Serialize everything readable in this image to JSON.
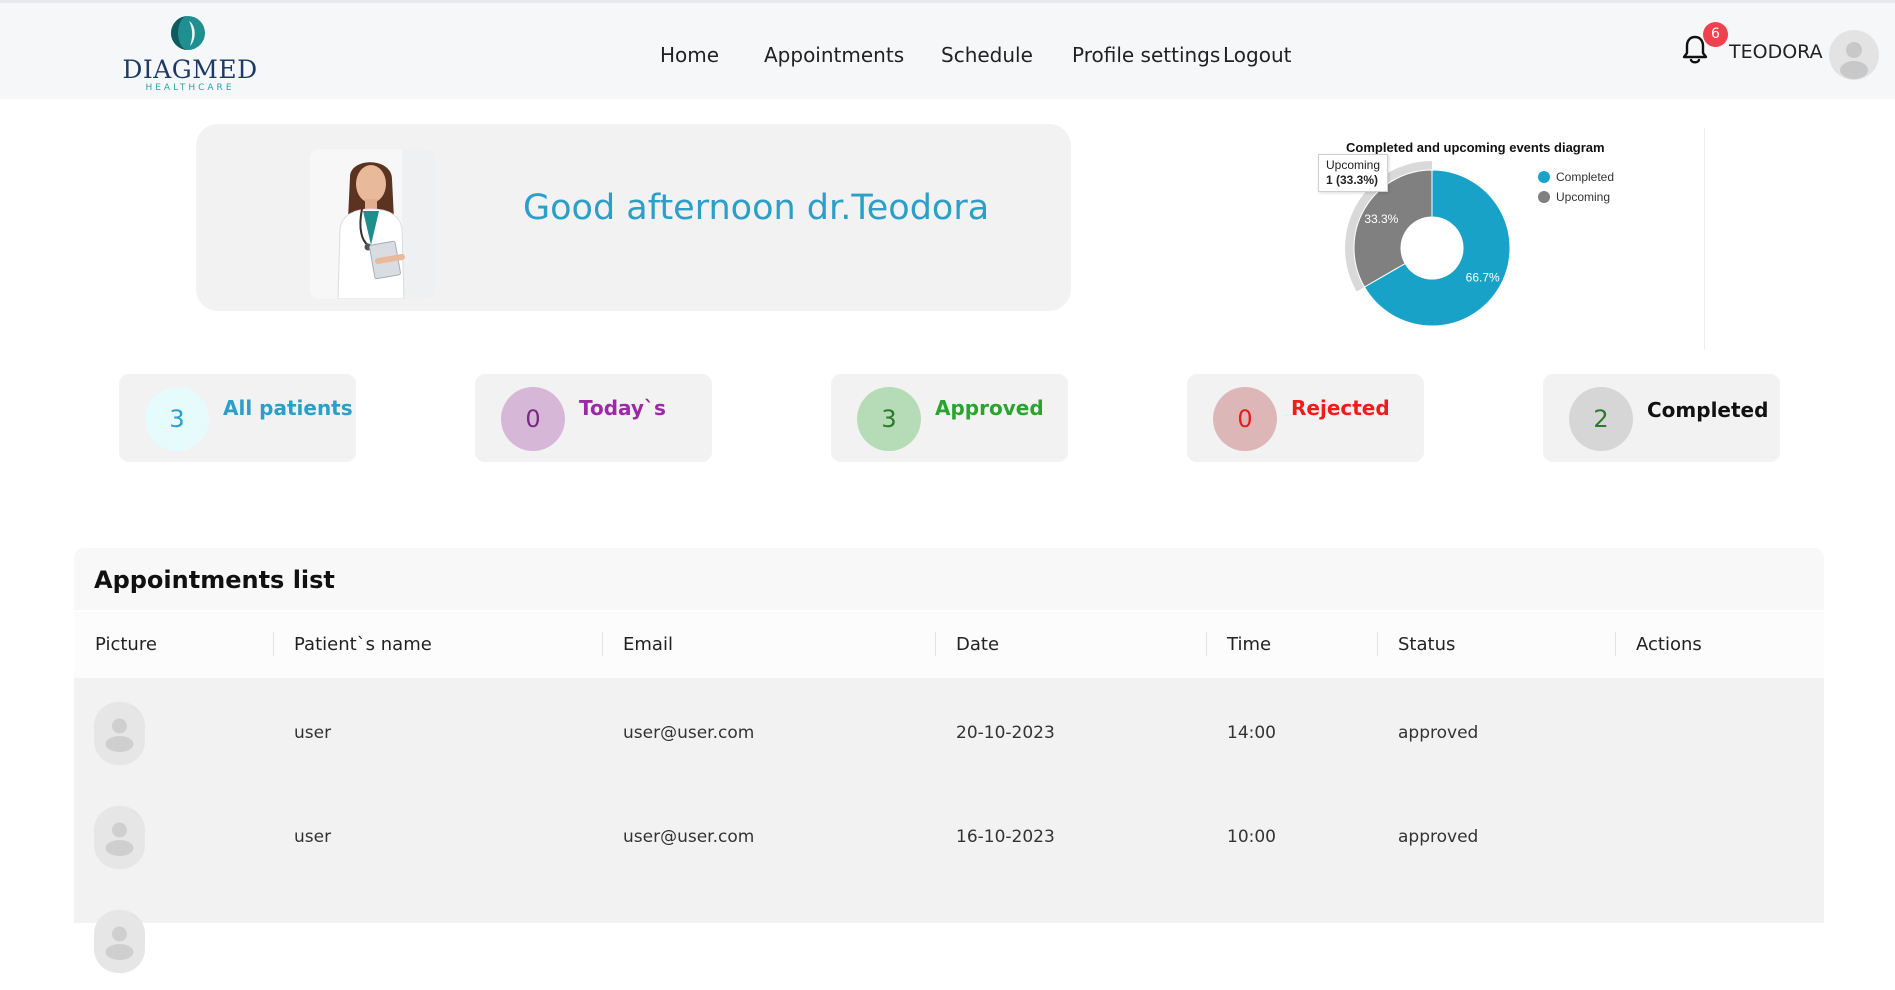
{
  "brand": {
    "name": "DIAGMED",
    "sub": "HEALTHCARE"
  },
  "nav": [
    {
      "label": "Home"
    },
    {
      "label": "Appointments"
    },
    {
      "label": "Schedule"
    },
    {
      "label": "Profile settings"
    },
    {
      "label": "Logout"
    }
  ],
  "header": {
    "notifications": "6",
    "username": "TEODORA"
  },
  "welcome": {
    "greeting": "Good afternoon dr.Teodora"
  },
  "chart": {
    "title": "Completed and upcoming events diagram",
    "legend": [
      "Completed",
      "Upcoming"
    ],
    "tooltip_label": "Upcoming",
    "tooltip_value": "1 (33.3%)",
    "slice_labels": [
      "66.7%",
      "33.3%"
    ]
  },
  "chart_data": {
    "type": "pie",
    "title": "Completed and upcoming events diagram",
    "categories": [
      "Completed",
      "Upcoming"
    ],
    "values": [
      2,
      1
    ],
    "percentages": [
      66.7,
      33.3
    ],
    "colors": [
      "#19a2c8",
      "#808080"
    ],
    "donut": true,
    "legend_position": "right"
  },
  "stats": [
    {
      "value": "3",
      "label": "All patients",
      "color": "#2a9fc7",
      "circle": "#e6fbfc"
    },
    {
      "value": "0",
      "label": "Today`s",
      "color": "#9c2aa6",
      "circle": "#d6b7d8"
    },
    {
      "value": "3",
      "label": "Approved",
      "color": "#2ba32f",
      "circle": "#b5dcb6"
    },
    {
      "value": "0",
      "label": "Rejected",
      "color": "#f01b1b",
      "circle": "#ddb7b7"
    },
    {
      "value": "2",
      "label": "Completed",
      "color": "#111111",
      "circle": "#d6d6d6"
    }
  ],
  "appointments": {
    "title": "Appointments list",
    "columns": [
      "Picture",
      "Patient`s name",
      "Email",
      "Date",
      "Time",
      "Status",
      "Actions"
    ],
    "rows": [
      {
        "name": "user",
        "email": "user@user.com",
        "date": "20-10-2023",
        "time": "14:00",
        "status": "approved"
      },
      {
        "name": "user",
        "email": "user@user.com",
        "date": "16-10-2023",
        "time": "10:00",
        "status": "approved"
      }
    ]
  }
}
